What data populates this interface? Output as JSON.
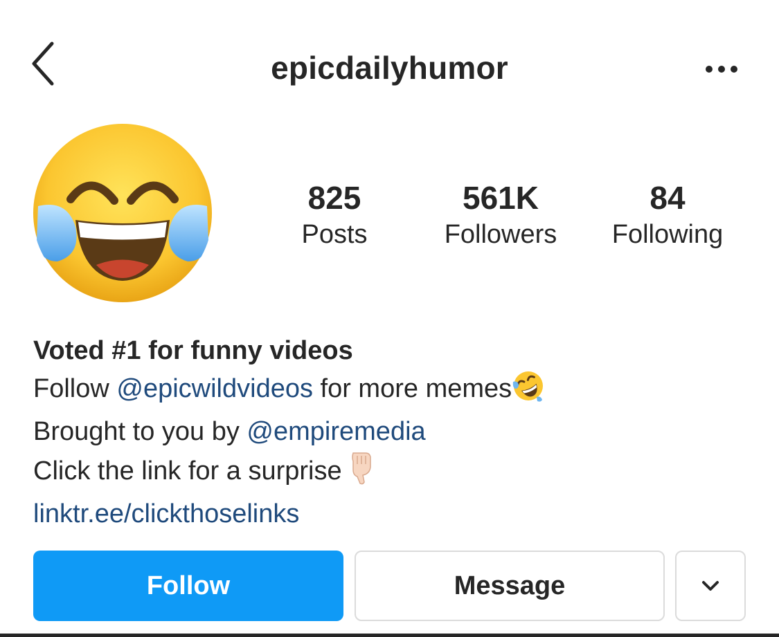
{
  "header": {
    "username": "epicdailyhumor",
    "back_icon": "chevron-left-icon",
    "more_icon": "more-horizontal-icon"
  },
  "profile": {
    "avatar_icon": "face-with-tears-of-joy-emoji",
    "stats": [
      {
        "value": "825",
        "label": "Posts"
      },
      {
        "value": "561K",
        "label": "Followers"
      },
      {
        "value": "84",
        "label": "Following"
      }
    ]
  },
  "bio": {
    "name": "Voted #1 for funny videos",
    "line1_prefix": "Follow ",
    "line1_mention": "@epicwildvideos",
    "line1_suffix": " for more memes",
    "line1_emoji": "rolling-on-floor-laughing-emoji",
    "line2_prefix": "Brought to you by ",
    "line2_mention": "@empiremedia",
    "line3_text": "Click the link for a surprise ",
    "line3_emoji": "backhand-index-pointing-down-emoji",
    "link": "linktr.ee/clickthoselinks"
  },
  "actions": {
    "follow_label": "Follow",
    "message_label": "Message",
    "dropdown_icon": "chevron-down-icon"
  },
  "colors": {
    "follow_button": "#0f9af6",
    "link": "#1f4a7c",
    "text": "#262626",
    "border": "#dbdbdb"
  }
}
